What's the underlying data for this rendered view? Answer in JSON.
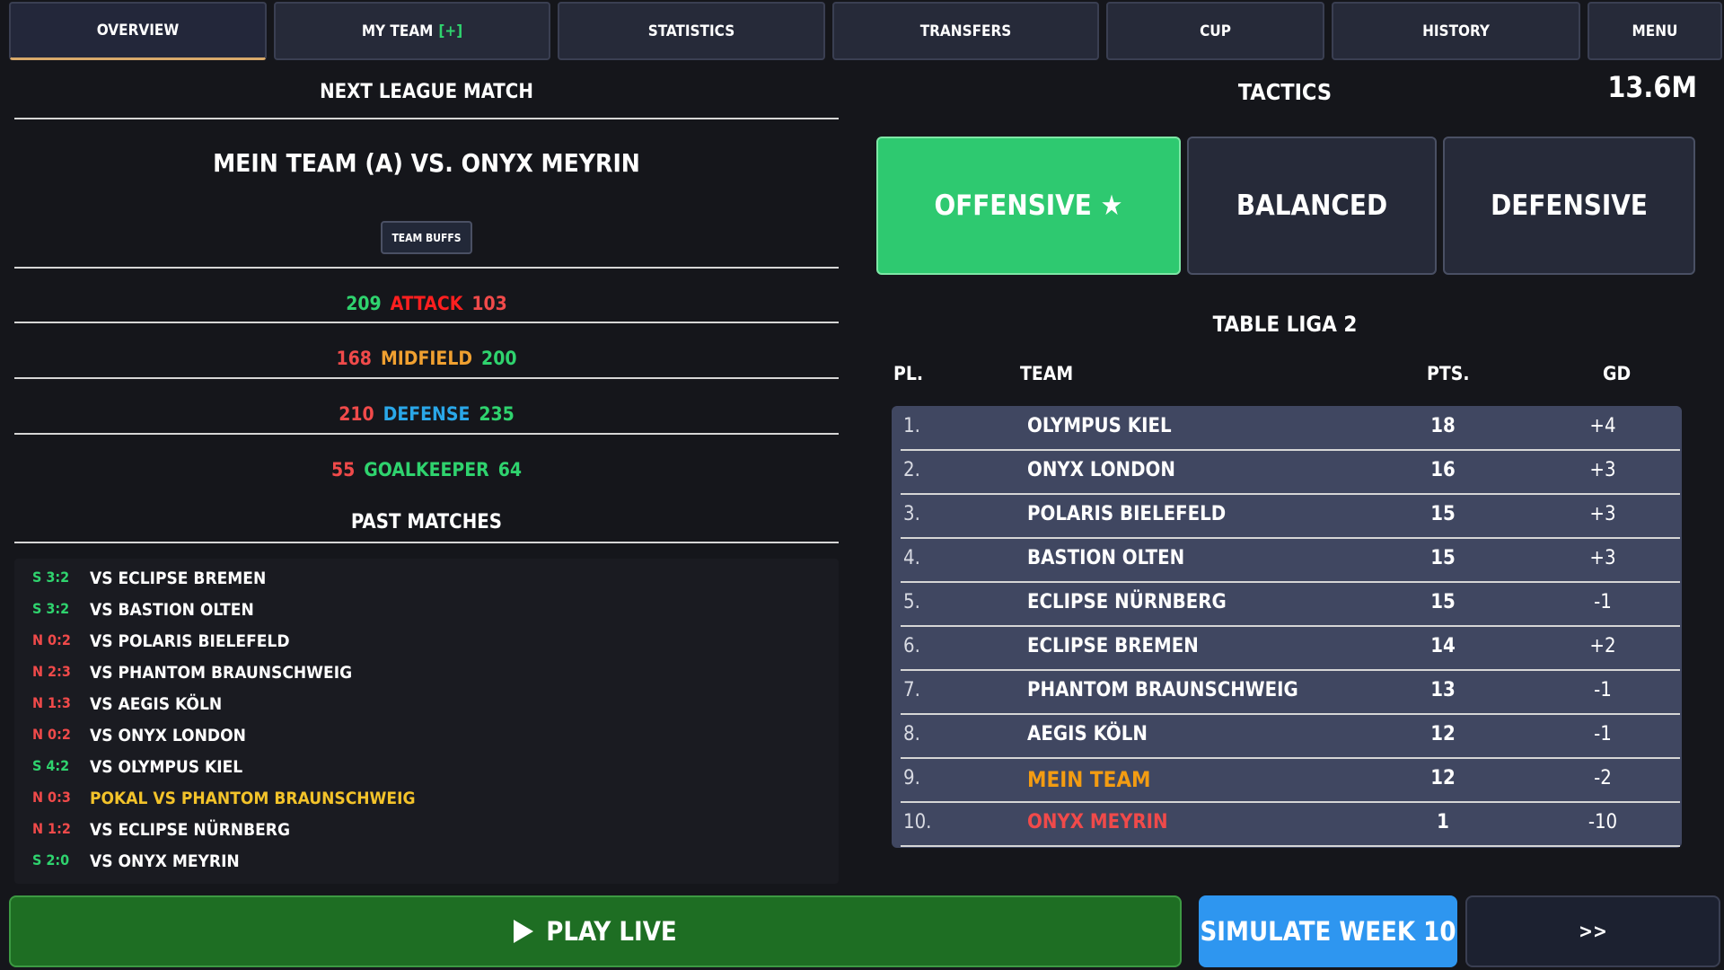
{
  "tabs": {
    "overview": "OVERVIEW",
    "my_team": "MY TEAM",
    "my_team_badge": "[+]",
    "statistics": "STATISTICS",
    "transfers": "TRANSFERS",
    "cup": "CUP",
    "history": "HISTORY",
    "menu": "MENU"
  },
  "money": "13.6M",
  "next_match": {
    "heading": "NEXT LEAGUE MATCH",
    "fixture": "MEIN TEAM (A) VS. ONYX MEYRIN",
    "buffs_label": "TEAM BUFFS",
    "comparisons": [
      {
        "left": "209",
        "label": "ATTACK",
        "right": "103"
      },
      {
        "left": "168",
        "label": "MIDFIELD",
        "right": "200"
      },
      {
        "left": "210",
        "label": "DEFENSE",
        "right": "235"
      },
      {
        "left": "55",
        "label": "GOALKEEPER",
        "right": "64"
      }
    ]
  },
  "past_matches": {
    "heading": "PAST MATCHES",
    "items": [
      {
        "result": "S 3:2",
        "text": "VS ECLIPSE BREMEN",
        "win": true
      },
      {
        "result": "S 3:2",
        "text": "VS BASTION OLTEN",
        "win": true
      },
      {
        "result": "N 0:2",
        "text": "VS POLARIS BIELEFELD",
        "win": false
      },
      {
        "result": "N 2:3",
        "text": "VS PHANTOM BRAUNSCHWEIG",
        "win": false
      },
      {
        "result": "N 1:3",
        "text": "VS AEGIS KÖLN",
        "win": false
      },
      {
        "result": "N 0:2",
        "text": "VS ONYX LONDON",
        "win": false
      },
      {
        "result": "S 4:2",
        "text": "VS OLYMPUS KIEL",
        "win": true
      },
      {
        "result": "N 0:3",
        "text": "POKAL VS PHANTOM BRAUNSCHWEIG",
        "win": false,
        "cup": true
      },
      {
        "result": "N 1:2",
        "text": "VS ECLIPSE NÜRNBERG",
        "win": false
      },
      {
        "result": "S 2:0",
        "text": "VS ONYX MEYRIN",
        "win": true
      }
    ]
  },
  "tactics": {
    "heading": "TACTICS",
    "offensive": "OFFENSIVE ★",
    "balanced": "BALANCED",
    "defensive": "DEFENSIVE",
    "selected": "offensive"
  },
  "table": {
    "heading": "TABLE LIGA 2",
    "headers": {
      "pl": "PL.",
      "team": "TEAM",
      "pts": "PTS.",
      "gd": "GD"
    },
    "rows": [
      {
        "pl": "1.",
        "team": "OLYMPUS KIEL",
        "pts": "18",
        "gd": "+4"
      },
      {
        "pl": "2.",
        "team": "ONYX LONDON",
        "pts": "16",
        "gd": "+3"
      },
      {
        "pl": "3.",
        "team": "POLARIS BIELEFELD",
        "pts": "15",
        "gd": "+3"
      },
      {
        "pl": "4.",
        "team": "BASTION OLTEN",
        "pts": "15",
        "gd": "+3"
      },
      {
        "pl": "5.",
        "team": "ECLIPSE NÜRNBERG",
        "pts": "15",
        "gd": "-1"
      },
      {
        "pl": "6.",
        "team": "ECLIPSE BREMEN",
        "pts": "14",
        "gd": "+2"
      },
      {
        "pl": "7.",
        "team": "PHANTOM BRAUNSCHWEIG",
        "pts": "13",
        "gd": "-1"
      },
      {
        "pl": "8.",
        "team": "AEGIS KÖLN",
        "pts": "12",
        "gd": "-1"
      },
      {
        "pl": "9.",
        "team": "MEIN TEAM",
        "pts": "12",
        "gd": "-2"
      },
      {
        "pl": "10.",
        "team": "ONYX MEYRIN",
        "pts": "1",
        "gd": "-10"
      }
    ]
  },
  "actions": {
    "play_live": "PLAY LIVE",
    "simulate": "SIMULATE WEEK 10",
    "next": ">>"
  },
  "colors": {
    "win": "#2fd36e",
    "loss": "#f04a4a",
    "cup": "#f3c32a",
    "accent_green": "#2ec970",
    "accent_blue": "#2e96f0",
    "my_team": "#f39c12"
  }
}
